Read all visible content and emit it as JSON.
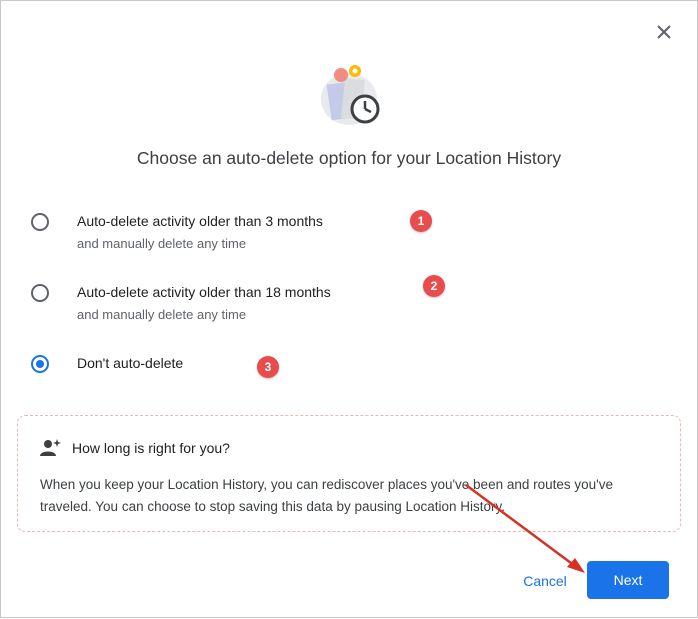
{
  "dialog": {
    "title": "Choose an auto-delete option for your Location History",
    "close_icon": "close-icon"
  },
  "options": [
    {
      "line1": "Auto-delete activity older than 3 months",
      "line2": "and manually delete any time",
      "selected": false,
      "badge": "1"
    },
    {
      "line1": "Auto-delete activity older than 18 months",
      "line2": "and manually delete any time",
      "selected": false,
      "badge": "2"
    },
    {
      "line1": "Don't auto-delete",
      "line2": "",
      "selected": true,
      "badge": "3"
    }
  ],
  "info": {
    "icon": "person-sparkle-icon",
    "title": "How long is right for you?",
    "body": "When you keep your Location History, you can rediscover places you've been and routes you've traveled. You can choose to stop saving this data by pausing Location History."
  },
  "footer": {
    "cancel_label": "Cancel",
    "next_label": "Next"
  },
  "colors": {
    "accent": "#1a73e8",
    "badge": "#e84c4c",
    "annotation_arrow": "#d93025"
  }
}
